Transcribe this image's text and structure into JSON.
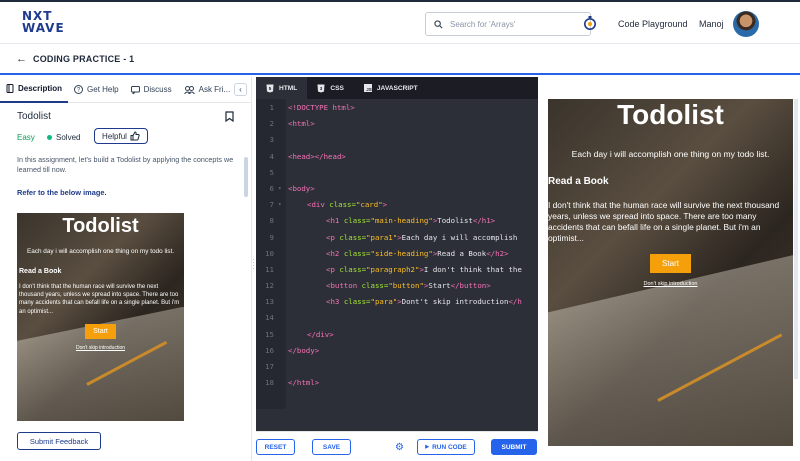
{
  "header": {
    "logo_line1": "NXT",
    "logo_line2": "WAVE",
    "search_placeholder": "Search for 'Arrays'",
    "code_playground": "Code Playground",
    "user_name": "Manoj"
  },
  "subheader": {
    "back_icon": "arrow-left-icon",
    "title": "CODING PRACTICE - 1"
  },
  "left_panel": {
    "tabs": [
      {
        "label": "Description",
        "icon": "book-icon"
      },
      {
        "label": "Get Help",
        "icon": "help-icon"
      },
      {
        "label": "Discuss",
        "icon": "chat-icon"
      },
      {
        "label": "Ask Fri...",
        "icon": "people-icon"
      }
    ],
    "problem_title": "Todolist",
    "difficulty": "Easy",
    "status": "Solved",
    "helpful_label": "Helpful",
    "description": "In this assignment, let's build a Todolist by applying the concepts we learned till now.",
    "refer": "Refer to the below image.",
    "feedback_button": "Submit Feedback"
  },
  "example": {
    "heading": "Todolist",
    "para1": "Each day i will accomplish one thing on my todo list.",
    "side_heading": "Read a Book",
    "paragraph2": "I don't think that the human race will survive the next thousand years, unless we spread into space. There are too many accidents that can befall life on a single planet. But i'm an optimist...",
    "button": "Start",
    "link": "Don't skip introduction"
  },
  "editor": {
    "tabs": [
      "HTML",
      "CSS",
      "JAVASCRIPT"
    ],
    "lines": [
      {
        "n": "1",
        "fold": "",
        "ind": 0,
        "parts": [
          [
            "tg",
            "<!DOCTYPE html>"
          ]
        ]
      },
      {
        "n": "2",
        "fold": "",
        "ind": 0,
        "parts": [
          [
            "tg",
            "<html>"
          ]
        ]
      },
      {
        "n": "3",
        "fold": "",
        "ind": 0,
        "parts": []
      },
      {
        "n": "4",
        "fold": "",
        "ind": 0,
        "parts": [
          [
            "tg",
            "<head></head>"
          ]
        ]
      },
      {
        "n": "5",
        "fold": "",
        "ind": 0,
        "parts": []
      },
      {
        "n": "6",
        "fold": "▾",
        "ind": 0,
        "parts": [
          [
            "tg",
            "<body>"
          ]
        ]
      },
      {
        "n": "7",
        "fold": "▾",
        "ind": 1,
        "parts": [
          [
            "tg",
            "<div "
          ],
          [
            "at",
            "class="
          ],
          [
            "st",
            "\"card\""
          ],
          [
            "tg",
            ">"
          ]
        ]
      },
      {
        "n": "8",
        "fold": "",
        "ind": 2,
        "parts": [
          [
            "tg",
            "<h1 "
          ],
          [
            "at",
            "class="
          ],
          [
            "st",
            "\"main-heading\""
          ],
          [
            "tg",
            ">"
          ],
          [
            "tx",
            "Todolist"
          ],
          [
            "tg",
            "</h1>"
          ]
        ]
      },
      {
        "n": "9",
        "fold": "",
        "ind": 2,
        "parts": [
          [
            "tg",
            "<p "
          ],
          [
            "at",
            "class="
          ],
          [
            "st",
            "\"para1\""
          ],
          [
            "tg",
            ">"
          ],
          [
            "tx",
            "Each day i will accomplish"
          ]
        ]
      },
      {
        "n": "10",
        "fold": "",
        "ind": 2,
        "parts": [
          [
            "tg",
            "<h2 "
          ],
          [
            "at",
            "class="
          ],
          [
            "st",
            "\"side-heading\""
          ],
          [
            "tg",
            ">"
          ],
          [
            "tx",
            "Read a Book"
          ],
          [
            "tg",
            "</h2>"
          ]
        ]
      },
      {
        "n": "11",
        "fold": "",
        "ind": 2,
        "parts": [
          [
            "tg",
            "<p "
          ],
          [
            "at",
            "class="
          ],
          [
            "st",
            "\"paragraph2\""
          ],
          [
            "tg",
            ">"
          ],
          [
            "tx",
            "I don't think that the"
          ]
        ]
      },
      {
        "n": "12",
        "fold": "",
        "ind": 2,
        "parts": [
          [
            "tg",
            "<button "
          ],
          [
            "at",
            "class="
          ],
          [
            "st",
            "\"button\""
          ],
          [
            "tg",
            ">"
          ],
          [
            "tx",
            "Start"
          ],
          [
            "tg",
            "</button>"
          ]
        ]
      },
      {
        "n": "13",
        "fold": "",
        "ind": 2,
        "parts": [
          [
            "tg",
            "<h3 "
          ],
          [
            "at",
            "class="
          ],
          [
            "st",
            "\"para\""
          ],
          [
            "tg",
            ">"
          ],
          [
            "tx",
            "Dont't skip introduction"
          ],
          [
            "tg",
            "</h"
          ]
        ]
      },
      {
        "n": "14",
        "fold": "",
        "ind": 0,
        "parts": []
      },
      {
        "n": "15",
        "fold": "",
        "ind": 1,
        "parts": [
          [
            "tg",
            "</div>"
          ]
        ]
      },
      {
        "n": "16",
        "fold": "",
        "ind": 0,
        "parts": [
          [
            "tg",
            "</body>"
          ]
        ]
      },
      {
        "n": "17",
        "fold": "",
        "ind": 0,
        "parts": []
      },
      {
        "n": "18",
        "fold": "",
        "ind": 0,
        "parts": [
          [
            "tg",
            "</html>"
          ]
        ]
      }
    ],
    "buttons": {
      "reset": "RESET",
      "save": "SAVE",
      "run": "RUN CODE",
      "submit": "SUBMIT"
    }
  },
  "colors": {
    "accent": "#2563eb",
    "brand": "#1f3b8f",
    "button_orange": "#f5a00a",
    "editor_bg": "#2d2f38"
  }
}
